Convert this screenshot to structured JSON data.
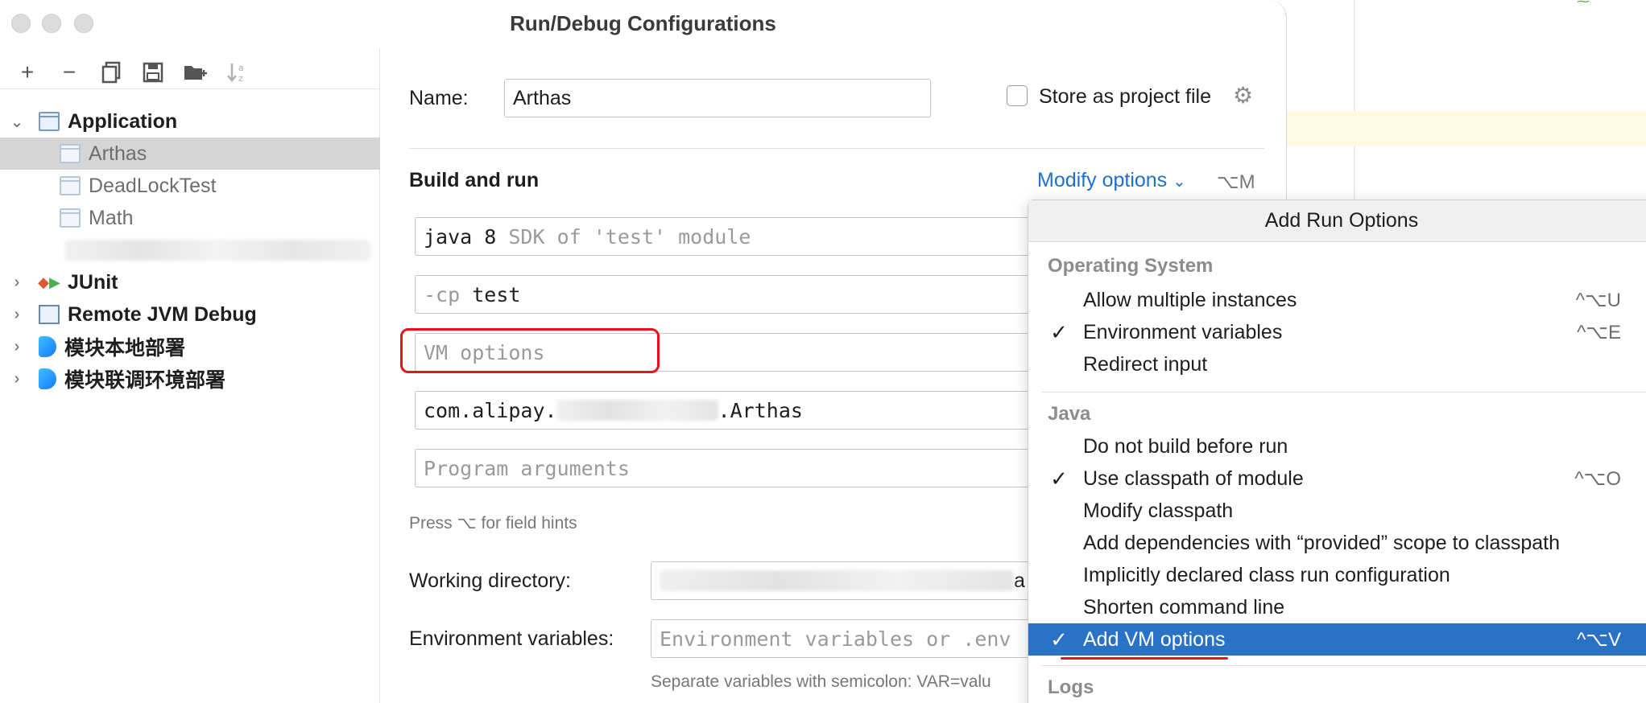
{
  "window": {
    "title": "Run/Debug Configurations"
  },
  "toolbar": {
    "add": "+",
    "remove": "−",
    "copy_icon": "copy-icon",
    "save_icon": "save-icon",
    "folder_icon": "new-folder-icon",
    "sort_icon": "sort-icon"
  },
  "tree": {
    "application": {
      "label": "Application",
      "children": [
        "Arthas",
        "DeadLockTest",
        "Math"
      ]
    },
    "junit": "JUnit",
    "remote": "Remote JVM Debug",
    "module_local": "模块本地部署",
    "module_joint": "模块联调环境部署"
  },
  "form": {
    "name_label": "Name:",
    "name_value": "Arthas",
    "store_label": "Store as project file",
    "section_title": "Build and run",
    "modify_options": "Modify options",
    "modify_shortcut": "⌥M",
    "sdk_value": "java 8",
    "sdk_hint": "SDK of 'test' module",
    "cp_flag": "-cp",
    "cp_value": "test",
    "vm_placeholder": "VM options",
    "main_class_prefix": "com.alipay.",
    "main_class_suffix": ".Arthas",
    "program_args_placeholder": "Program arguments",
    "field_hint": "Press ⌥ for field hints",
    "workdir_label": "Working directory:",
    "workdir_trailing": "a",
    "env_label": "Environment variables:",
    "env_placeholder": "Environment variables or .env",
    "env_hint": "Separate variables with semicolon: VAR=valu"
  },
  "popup": {
    "title": "Add Run Options",
    "groups": [
      {
        "name": "Operating System",
        "items": [
          {
            "label": "Allow multiple instances",
            "checked": false,
            "shortcut": "^⌥U"
          },
          {
            "label": "Environment variables",
            "checked": true,
            "shortcut": "^⌥E"
          },
          {
            "label": "Redirect input",
            "checked": false,
            "shortcut": ""
          }
        ]
      },
      {
        "name": "Java",
        "items": [
          {
            "label": "Do not build before run",
            "checked": false,
            "shortcut": ""
          },
          {
            "label": "Use classpath of module",
            "checked": true,
            "shortcut": "^⌥O"
          },
          {
            "label": "Modify classpath",
            "checked": false,
            "shortcut": ""
          },
          {
            "label": "Add dependencies with “provided” scope to classpath",
            "checked": false,
            "shortcut": ""
          },
          {
            "label": "Implicitly declared class run configuration",
            "checked": false,
            "shortcut": ""
          },
          {
            "label": "Shorten command line",
            "checked": false,
            "shortcut": ""
          },
          {
            "label": "Add VM options",
            "checked": true,
            "shortcut": "^⌥V",
            "active": true
          }
        ]
      },
      {
        "name": "Logs",
        "items": []
      }
    ],
    "check_glyph": "✓"
  },
  "colors": {
    "accent": "#2a72c6",
    "link": "#1f6fcf",
    "annotation": "#e8121a"
  }
}
